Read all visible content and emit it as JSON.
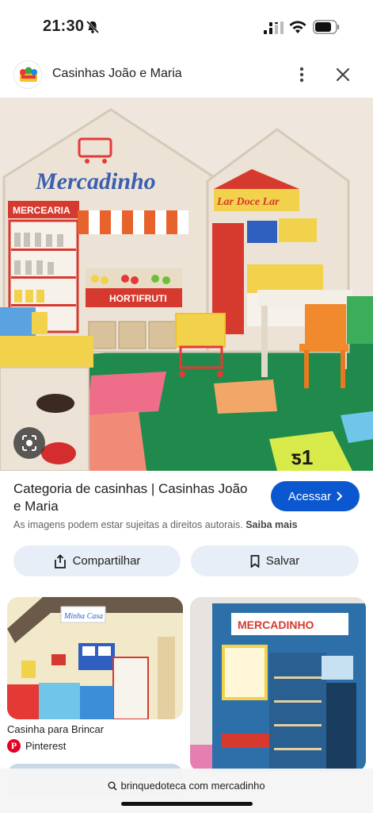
{
  "status_bar": {
    "time": "21:30",
    "icons": [
      "bell-slash-icon",
      "cellular-signal-icon",
      "wifi-icon",
      "battery-icon"
    ]
  },
  "header": {
    "source_name": "Casinhas João e Maria",
    "logo": "casinhas-logo",
    "more_icon": "more-vert-icon",
    "close_icon": "close-icon"
  },
  "hero": {
    "sign_mercadinho": "Mercadinho",
    "sign_mercearia": "MERCEARIA",
    "sign_hortifruti": "HORTIFRUTI",
    "sign_lar": "Lar Doce Lar",
    "lens_icon": "lens-icon"
  },
  "result": {
    "title": "Categoria de casinhas | Casinhas João e Maria",
    "visit_label": "Acessar",
    "disclaimer_text": "As imagens podem estar sujeitas a direitos autorais.",
    "disclaimer_link": "Saiba mais",
    "share_label": "Compartilhar",
    "save_label": "Salvar"
  },
  "related": [
    {
      "title": "Casinha para Brincar",
      "source": "Pinterest",
      "sign": "Minha Casa"
    },
    {
      "sign": "MERCADINHO"
    }
  ],
  "bottom": {
    "search_text": "brinquedoteca com mercadinho"
  },
  "colors": {
    "accent": "#0b57d0",
    "chip_bg": "#e8eef8",
    "pinterest": "#e60023"
  }
}
